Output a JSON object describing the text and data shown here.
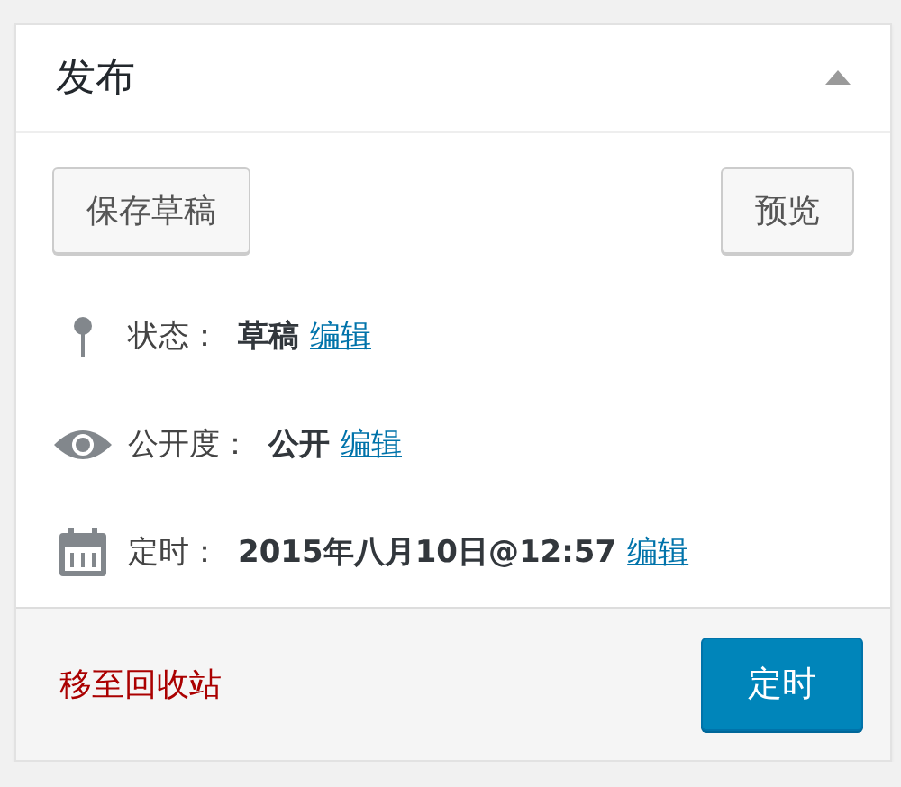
{
  "panel": {
    "title": "发布",
    "expanded": true
  },
  "actions": [
    {
      "label": "保存草稿"
    },
    {
      "label": "预览"
    }
  ],
  "fields": [
    {
      "kind": "status",
      "label": "状态：",
      "value": "草稿",
      "link": "编辑"
    },
    {
      "kind": "visibility",
      "label": "公开度：",
      "value": "公开",
      "link": "编辑"
    },
    {
      "kind": "schedule",
      "label": "定时：",
      "value": "2015年八月10日@12:57",
      "link": "编辑"
    }
  ],
  "footer": {
    "delete_link": "移至回收站",
    "primary_button": "定时"
  }
}
